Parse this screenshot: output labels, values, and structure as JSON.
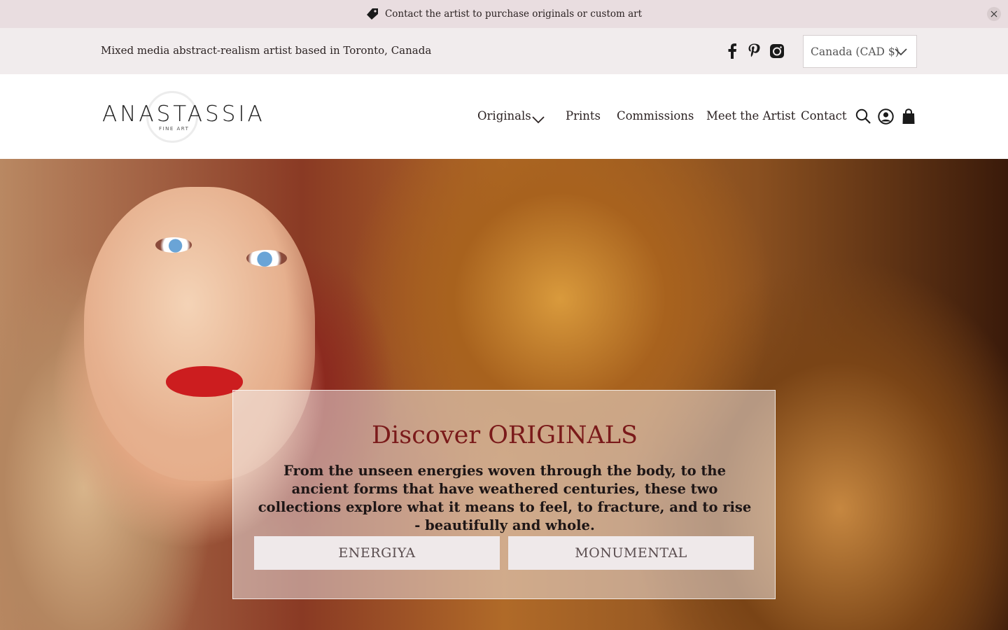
{
  "announcement": {
    "text": "Contact the artist to purchase originals or custom art",
    "icon": "tag-icon",
    "close_icon": "close-icon"
  },
  "topbar": {
    "tagline": "Mixed media abstract-realism artist based in Toronto, Canada",
    "social": [
      "facebook-icon",
      "pinterest-icon",
      "instagram-icon"
    ],
    "currency": "Canada (CAD $)"
  },
  "header": {
    "logo": {
      "name": "ANASTASSIA",
      "sub": "FINE ART"
    },
    "nav": [
      {
        "label": "Originals",
        "has_dropdown": true
      },
      {
        "label": "Prints"
      },
      {
        "label": "Commissions"
      },
      {
        "label": "Meet the Artist"
      },
      {
        "label": "Contact"
      }
    ],
    "icons": [
      "search-icon",
      "account-icon",
      "cart-icon"
    ]
  },
  "hero": {
    "title": "Discover ORIGINALS",
    "body": "From the unseen energies woven through the body, to the ancient forms that have weathered centuries, these two collections explore what it means to feel, to fracture, and to rise - beautifully and whole.",
    "buttons": [
      "ENERGIYA",
      "MONUMENTAL"
    ]
  },
  "colors": {
    "announcement_bg": "#e9dde0",
    "topbar_bg": "#f1eced",
    "title_accent": "#7a1a1a",
    "button_bg": "#efe9ea"
  }
}
